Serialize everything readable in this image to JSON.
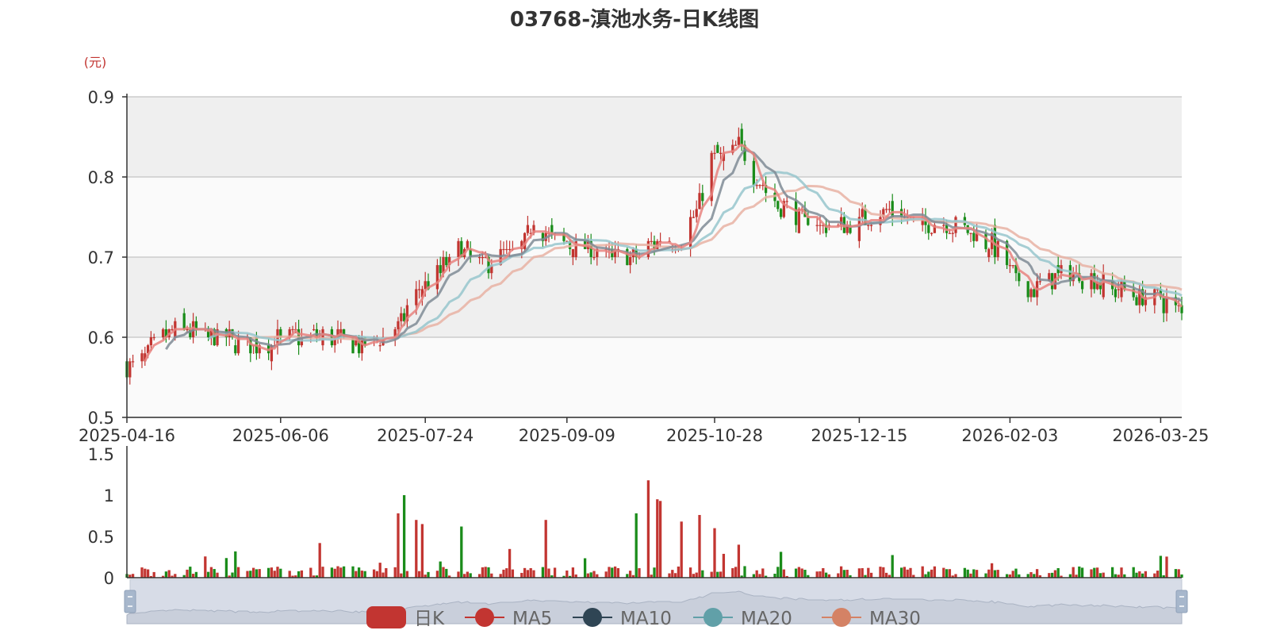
{
  "chart_data": {
    "type": "candlestick",
    "title": "03768-滇池水务-日K线图",
    "price_unit": "(元)",
    "price_axis": {
      "ylim": [
        0.5,
        0.9
      ],
      "ticks": [
        "0.5",
        "0.6",
        "0.7",
        "0.8",
        "0.9"
      ]
    },
    "volume_axis": {
      "ylim": [
        0,
        1.5
      ],
      "ticks": [
        "0",
        "0.5",
        "1",
        "1.5"
      ]
    },
    "x_date_range": [
      "2025-04-16",
      "2026-04-01"
    ],
    "x_tick_labels": [
      "2025-04-16",
      "2025-06-06",
      "2025-07-24",
      "2025-09-09",
      "2025-10-28",
      "2025-12-15",
      "2026-02-03",
      "2026-03-25"
    ],
    "legend": [
      "日K",
      "MA5",
      "MA10",
      "MA20",
      "MA30"
    ],
    "colors": {
      "up": "#c23531",
      "down": "#1a8c1a",
      "MA5": "#e8827f",
      "MA10": "#7f8b95",
      "MA20": "#97c6cc",
      "MA30": "#e7b2a3",
      "legend_k": "#c23531",
      "legend_ma5": "#c23531",
      "legend_ma10": "#2f4554",
      "legend_ma20": "#61a0a8",
      "legend_ma30": "#d48265",
      "grid_band": "#efefef",
      "axis": "#333333"
    },
    "close_keypoints": [
      [
        "2025-04-16",
        0.56
      ],
      [
        "2025-04-22",
        0.58
      ],
      [
        "2025-04-28",
        0.6
      ],
      [
        "2025-05-05",
        0.61
      ],
      [
        "2025-05-15",
        0.6
      ],
      [
        "2025-05-28",
        0.59
      ],
      [
        "2025-06-10",
        0.6
      ],
      [
        "2025-06-25",
        0.6
      ],
      [
        "2025-07-03",
        0.59
      ],
      [
        "2025-07-10",
        0.6
      ],
      [
        "2025-07-16",
        0.62
      ],
      [
        "2025-07-22",
        0.66
      ],
      [
        "2025-07-28",
        0.68
      ],
      [
        "2025-08-05",
        0.71
      ],
      [
        "2025-08-12",
        0.69
      ],
      [
        "2025-08-18",
        0.7
      ],
      [
        "2025-08-25",
        0.71
      ],
      [
        "2025-08-29",
        0.75
      ],
      [
        "2025-09-02",
        0.73
      ],
      [
        "2025-09-08",
        0.72
      ],
      [
        "2025-09-16",
        0.71
      ],
      [
        "2025-09-24",
        0.7
      ],
      [
        "2025-10-02",
        0.7
      ],
      [
        "2025-10-10",
        0.72
      ],
      [
        "2025-10-17",
        0.72
      ],
      [
        "2025-10-23",
        0.77
      ],
      [
        "2025-10-27",
        0.82
      ],
      [
        "2025-10-31",
        0.83
      ],
      [
        "2025-11-05",
        0.84
      ],
      [
        "2025-11-10",
        0.8
      ],
      [
        "2025-11-17",
        0.77
      ],
      [
        "2025-11-24",
        0.75
      ],
      [
        "2025-12-02",
        0.74
      ],
      [
        "2025-12-10",
        0.74
      ],
      [
        "2025-12-18",
        0.75
      ],
      [
        "2025-12-24",
        0.76
      ],
      [
        "2026-01-05",
        0.74
      ],
      [
        "2026-01-14",
        0.74
      ],
      [
        "2026-01-22",
        0.73
      ],
      [
        "2026-01-30",
        0.71
      ],
      [
        "2026-02-05",
        0.67
      ],
      [
        "2026-02-10",
        0.66
      ],
      [
        "2026-02-16",
        0.67
      ],
      [
        "2026-02-24",
        0.68
      ],
      [
        "2026-03-04",
        0.67
      ],
      [
        "2026-03-10",
        0.66
      ],
      [
        "2026-03-18",
        0.65
      ],
      [
        "2026-03-24",
        0.65
      ],
      [
        "2026-04-01",
        0.63
      ]
    ],
    "volume_keypoints": [
      [
        "2025-06-19",
        0.42
      ],
      [
        "2025-07-15",
        0.78
      ],
      [
        "2025-07-17",
        1.0
      ],
      [
        "2025-07-21",
        0.7
      ],
      [
        "2025-07-23",
        0.65
      ],
      [
        "2025-08-05",
        0.62
      ],
      [
        "2025-09-02",
        0.7
      ],
      [
        "2025-10-02",
        0.78
      ],
      [
        "2025-10-06",
        1.18
      ],
      [
        "2025-10-09",
        0.95
      ],
      [
        "2025-10-10",
        0.93
      ],
      [
        "2025-10-17",
        0.68
      ],
      [
        "2025-10-23",
        0.76
      ],
      [
        "2025-10-28",
        0.6
      ],
      [
        "2025-11-05",
        0.4
      ]
    ]
  }
}
